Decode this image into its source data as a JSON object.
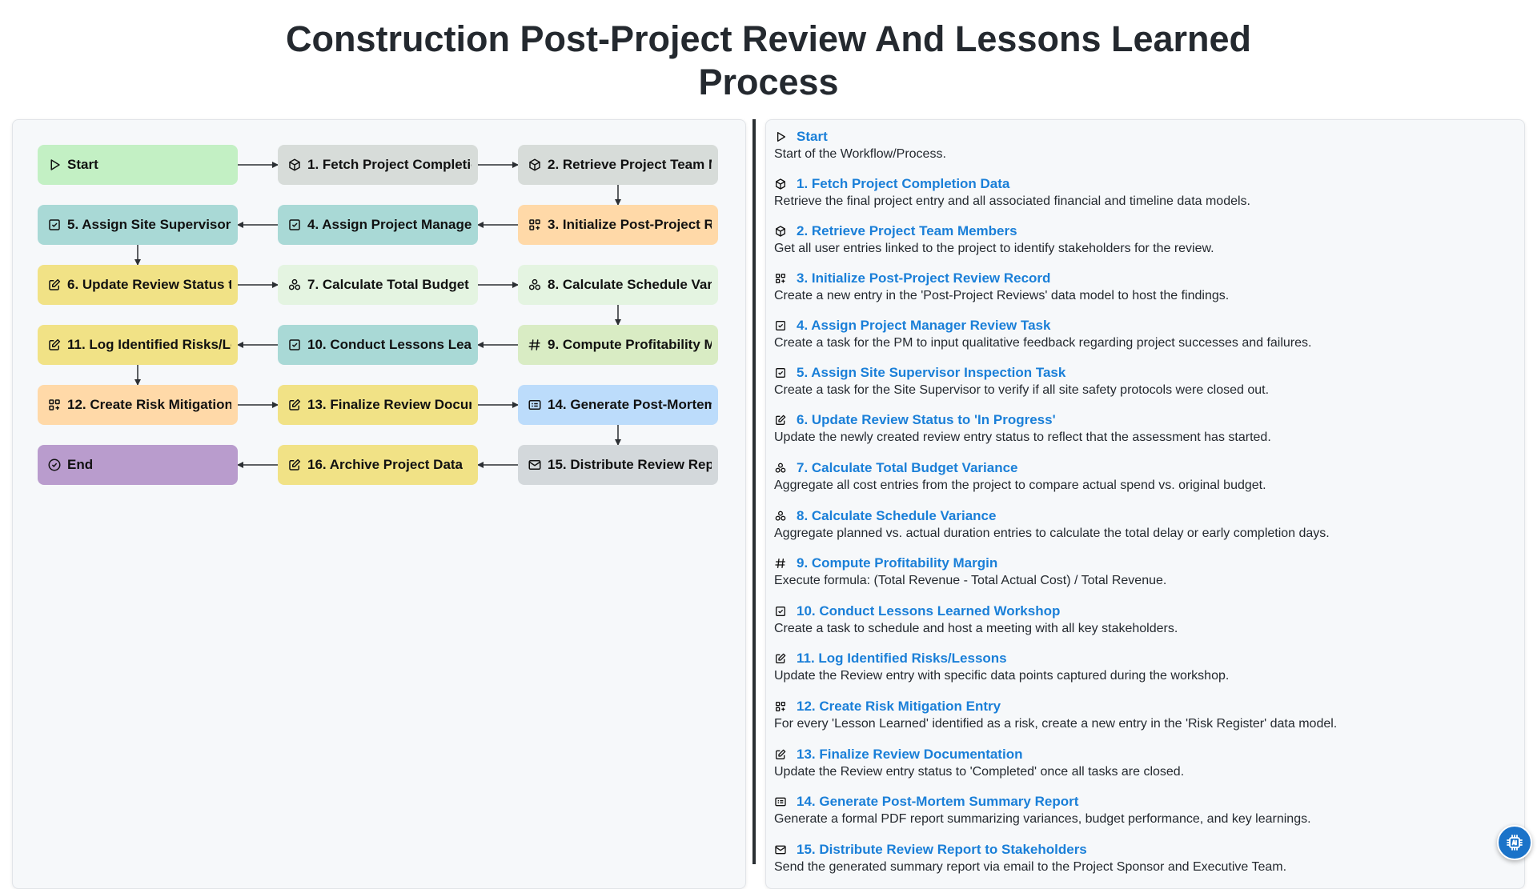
{
  "title_lines": [
    "Construction Post-Project Review And Lessons Learned",
    "Process"
  ],
  "colors": {
    "accent_link": "#1a7fd8",
    "start": "#c3f0c4",
    "task": "#a9d9d6",
    "update": "#f1e286",
    "create": "#ffd9a8",
    "aggregate": "#e4f4e1",
    "formula": "#d9ecc4",
    "report": "#bcdcfb",
    "fetch": "#d7dcd9",
    "end": "#b99ccd"
  },
  "nodes": [
    {
      "label": "Start",
      "icon": "play-icon"
    },
    {
      "label": "1. Fetch Project Completion Data",
      "icon": "box-icon"
    },
    {
      "label": "2. Retrieve Project Team Members",
      "icon": "box-icon"
    },
    {
      "label": "3. Initialize Post-Project Review Record",
      "icon": "grid-plus-icon"
    },
    {
      "label": "4. Assign Project Manager Review Task",
      "icon": "checkbox-icon"
    },
    {
      "label": "5. Assign Site Supervisor Inspection Task",
      "icon": "checkbox-icon"
    },
    {
      "label": "6. Update Review Status to 'In Progress'",
      "icon": "edit-icon"
    },
    {
      "label": "7. Calculate Total Budget Variance",
      "icon": "aggregate-icon"
    },
    {
      "label": "8. Calculate Schedule Variance",
      "icon": "aggregate-icon"
    },
    {
      "label": "9. Compute Profitability Margin",
      "icon": "formula-icon"
    },
    {
      "label": "10. Conduct Lessons Learned Workshop",
      "icon": "checkbox-icon"
    },
    {
      "label": "11. Log Identified Risks/Lessons",
      "icon": "edit-icon"
    },
    {
      "label": "12. Create Risk Mitigation Entry",
      "icon": "grid-plus-icon"
    },
    {
      "label": "13. Finalize Review Documentation",
      "icon": "edit-icon"
    },
    {
      "label": "14. Generate Post-Mortem Summary Report",
      "icon": "report-icon"
    },
    {
      "label": "15. Distribute Review Report to Stakeholders",
      "icon": "mail-icon"
    },
    {
      "label": "16. Archive Project Data",
      "icon": "edit-icon"
    },
    {
      "label": "End",
      "icon": "check-circle-icon"
    }
  ],
  "steps": [
    {
      "title": "Start",
      "desc": "Start of the Workflow/Process."
    },
    {
      "title": "1. Fetch Project Completion Data",
      "desc": "Retrieve the final project entry and all associated financial and timeline data models."
    },
    {
      "title": "2. Retrieve Project Team Members",
      "desc": "Get all user entries linked to the project to identify stakeholders for the review."
    },
    {
      "title": "3. Initialize Post-Project Review Record",
      "desc": "Create a new entry in the 'Post-Project Reviews' data model to host the findings."
    },
    {
      "title": "4. Assign Project Manager Review Task",
      "desc": "Create a task for the PM to input qualitative feedback regarding project successes and failures."
    },
    {
      "title": "5. Assign Site Supervisor Inspection Task",
      "desc": "Create a task for the Site Supervisor to verify if all site safety protocols were closed out."
    },
    {
      "title": "6. Update Review Status to 'In Progress'",
      "desc": "Update the newly created review entry status to reflect that the assessment has started."
    },
    {
      "title": "7. Calculate Total Budget Variance",
      "desc": "Aggregate all cost entries from the project to compare actual spend vs. original budget."
    },
    {
      "title": "8. Calculate Schedule Variance",
      "desc": "Aggregate planned vs. actual duration entries to calculate the total delay or early completion days."
    },
    {
      "title": "9. Compute Profitability Margin",
      "desc": "Execute formula: (Total Revenue - Total Actual Cost) / Total Revenue."
    },
    {
      "title": "10. Conduct Lessons Learned Workshop",
      "desc": "Create a task to schedule and host a meeting with all key stakeholders."
    },
    {
      "title": "11. Log Identified Risks/Lessons",
      "desc": "Update the Review entry with specific data points captured during the workshop."
    },
    {
      "title": "12. Create Risk Mitigation Entry",
      "desc": "For every 'Lesson Learned' identified as a risk, create a new entry in the 'Risk Register' data model."
    },
    {
      "title": "13. Finalize Review Documentation",
      "desc": "Update the Review entry status to 'Completed' once all tasks are closed."
    },
    {
      "title": "14. Generate Post-Mortem Summary Report",
      "desc": "Generate a formal PDF report summarizing variances, budget performance, and key learnings."
    },
    {
      "title": "15. Distribute Review Report to Stakeholders",
      "desc": "Send the generated summary report via email to the Project Sponsor and Executive Team."
    }
  ]
}
